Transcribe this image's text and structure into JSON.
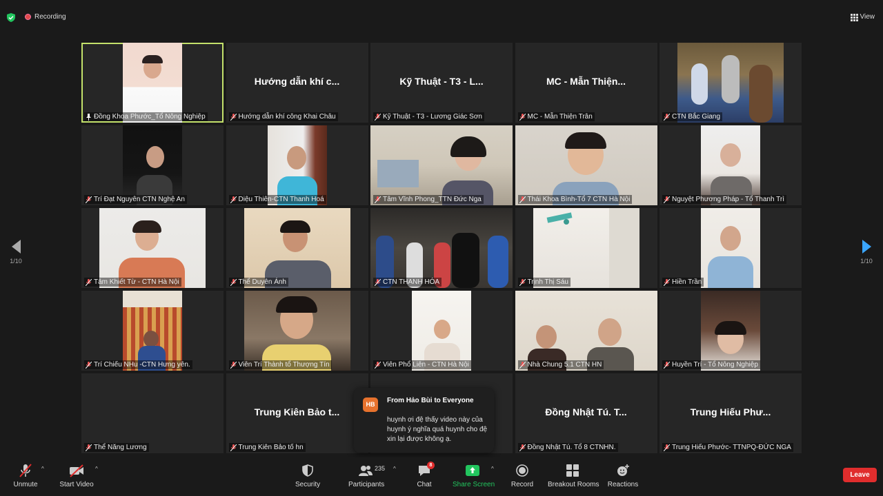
{
  "top_bar": {
    "recording_label": "Recording",
    "view_label": "View"
  },
  "nav": {
    "left_page": "1/10",
    "right_page": "1/10"
  },
  "tiles": [
    {
      "name": "Đồng Khoa Phước_Tổ Nông Nghiệp",
      "big": ""
    },
    {
      "name": "Hướng dẫn khí công Khai Châu",
      "big": "Hướng dẫn khí c..."
    },
    {
      "name": "Kỹ Thuật - T3 - Lương Giác Sơn",
      "big": "Kỹ Thuật - T3 - L..."
    },
    {
      "name": "MC - Mẫn Thiện Trân",
      "big": "MC - Mẫn Thiện..."
    },
    {
      "name": "CTN Bắc Giang",
      "big": ""
    },
    {
      "name": "Trí Đạt Nguyên CTN Nghệ An",
      "big": ""
    },
    {
      "name": "Diệu Thiên-CTN Thanh Hoá",
      "big": ""
    },
    {
      "name": "Tâm Vĩnh Phong_TTN Đức Nga",
      "big": ""
    },
    {
      "name": "Thái Khoa Bình-Tổ 7 CTN Hà Nội",
      "big": ""
    },
    {
      "name": "Nguyệt Phương Pháp - Tổ Thanh Trì",
      "big": ""
    },
    {
      "name": "Tâm Khiết Từ - CTN Hà Nội",
      "big": ""
    },
    {
      "name": "Thể Duyên Ánh",
      "big": ""
    },
    {
      "name": "CTN THANH HÓA",
      "big": ""
    },
    {
      "name": "Trịnh Thị Sáu",
      "big": ""
    },
    {
      "name": "Hiền Trần",
      "big": ""
    },
    {
      "name": "Trí Chiếu NHu -CTN Hưng yên.",
      "big": ""
    },
    {
      "name": "Viên Trí Thành tổ Thượng Tín",
      "big": ""
    },
    {
      "name": "Viên Phổ Liên - CTN Hà Nội",
      "big": ""
    },
    {
      "name": "Nhà Chung 5.1 CTN HN",
      "big": ""
    },
    {
      "name": "Huyền Trí - Tổ Nông Nghiệp",
      "big": ""
    },
    {
      "name": "Thể Năng Lương",
      "big": ""
    },
    {
      "name": "Trung Kiên Bảo tố hn",
      "big": "Trung Kiên Bảo t..."
    },
    {
      "name": "",
      "big": ""
    },
    {
      "name": "Đồng Nhật Tú. Tổ 8 CTNHN.",
      "big": "Đồng Nhật Tú. T..."
    },
    {
      "name": "Trung Hiếu Phước- TTNPQ-ĐỨC NGA",
      "big": "Trung Hiếu Phư..."
    }
  ],
  "chat_popup": {
    "initials": "HB",
    "from": "From Hảo Bùi to Everyone",
    "message": "huynh ơi đệ thấy video này của huynh ý nghĩa quá huynh cho đệ xin lại được không ạ."
  },
  "toolbar": {
    "unmute": "Unmute",
    "start_video": "Start Video",
    "security": "Security",
    "participants": "Participants",
    "participants_count": "235",
    "chat": "Chat",
    "chat_badge": "8",
    "share_screen": "Share Screen",
    "record": "Record",
    "breakout_rooms": "Breakout Rooms",
    "reactions": "Reactions",
    "leave": "Leave"
  },
  "colors": {
    "active_speaker": "#c4e26b",
    "share_green": "#22c55e",
    "leave_red": "#e02d2d",
    "chat_badge_bg": "#e7722d"
  }
}
